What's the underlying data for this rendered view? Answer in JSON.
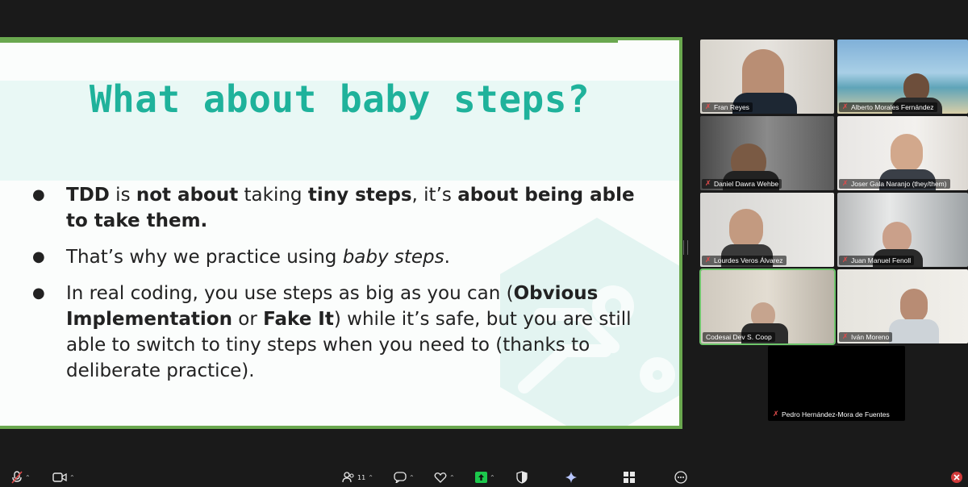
{
  "slide": {
    "title": "What about baby steps?",
    "bullet1": {
      "b1": "TDD",
      "t1": " is ",
      "b2": "not about",
      "t2": " taking ",
      "b3": "tiny steps",
      "t3": ", it’s ",
      "b4": "about being able to take them."
    },
    "bullet2": {
      "t1": "That’s why we practice using ",
      "i1": "baby steps",
      "t2": "."
    },
    "bullet3": {
      "t1": "In real coding, you use steps as big as you can (",
      "b1": "Obvious Implementation",
      "t2": " or ",
      "b2": "Fake It",
      "t3": ") while it’s safe, but you are still able to switch to tiny steps when you need to (thanks to deliberate practice)."
    }
  },
  "participants": [
    {
      "name": "Fran Reyes",
      "muted": true
    },
    {
      "name": "Alberto Morales Fernández",
      "muted": true
    },
    {
      "name": "Daniel Dawra Wehbe",
      "muted": true
    },
    {
      "name": "Joser Gala Naranjo (they/them)",
      "muted": true
    },
    {
      "name": "Lourdes Veros Álvarez",
      "muted": true
    },
    {
      "name": "Juan Manuel Fenoll",
      "muted": true
    },
    {
      "name": "Codesai Dev S. Coop",
      "muted": false,
      "active_speaker": true
    },
    {
      "name": "Iván Moreno",
      "muted": true
    },
    {
      "name": "Pedro Hernández-Mora de Fuentes",
      "muted": true
    }
  ],
  "toolbar": {
    "participants_count": "11"
  },
  "colors": {
    "accent_teal": "#1fb29b",
    "share_border": "#6aa84f",
    "active_speaker": "#6ec56b",
    "muted_red": "#e04b4b"
  }
}
